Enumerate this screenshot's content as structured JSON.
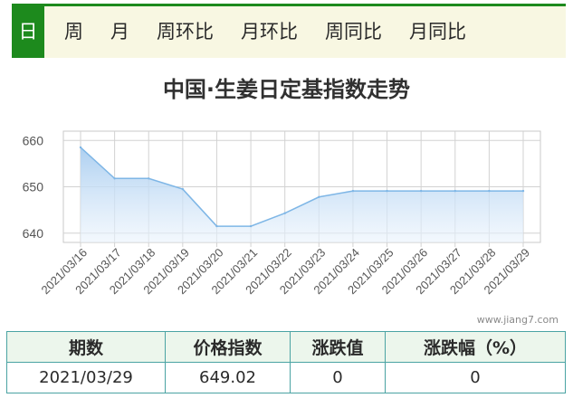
{
  "tabs": [
    {
      "label": "日",
      "active": true
    },
    {
      "label": "周",
      "active": false
    },
    {
      "label": "月",
      "active": false
    },
    {
      "label": "周环比",
      "active": false
    },
    {
      "label": "月环比",
      "active": false
    },
    {
      "label": "周同比",
      "active": false
    },
    {
      "label": "月同比",
      "active": false
    }
  ],
  "colors": {
    "accent": "#1d8a1d",
    "tab_bar_bg": "#f8f7e2",
    "line": "#7eb6e6",
    "fill_top": "#a9cdf0",
    "table_border": "#4aa3a3"
  },
  "chart_data": {
    "type": "area",
    "title": "中国·生姜日定基指数走势",
    "xlabel": "",
    "ylabel": "",
    "categories": [
      "2021/03/16",
      "2021/03/17",
      "2021/03/18",
      "2021/03/19",
      "2021/03/20",
      "2021/03/21",
      "2021/03/22",
      "2021/03/23",
      "2021/03/24",
      "2021/03/25",
      "2021/03/26",
      "2021/03/27",
      "2021/03/28",
      "2021/03/29"
    ],
    "ticks_y": [
      640,
      650,
      660
    ],
    "ylim": [
      638,
      662
    ],
    "grid": true,
    "series": [
      {
        "values": [
          658.5,
          651.8,
          651.8,
          649.5,
          641.5,
          641.5,
          644.3,
          647.8,
          649.1,
          649.1,
          649.1,
          649.1,
          649.1,
          649.1
        ]
      }
    ]
  },
  "watermark": "www.jiang7.com",
  "table": {
    "headers": [
      "期数",
      "价格指数",
      "涨跌值",
      "涨跌幅（%）"
    ],
    "row": [
      "2021/03/29",
      "649.02",
      "0",
      "0"
    ]
  }
}
